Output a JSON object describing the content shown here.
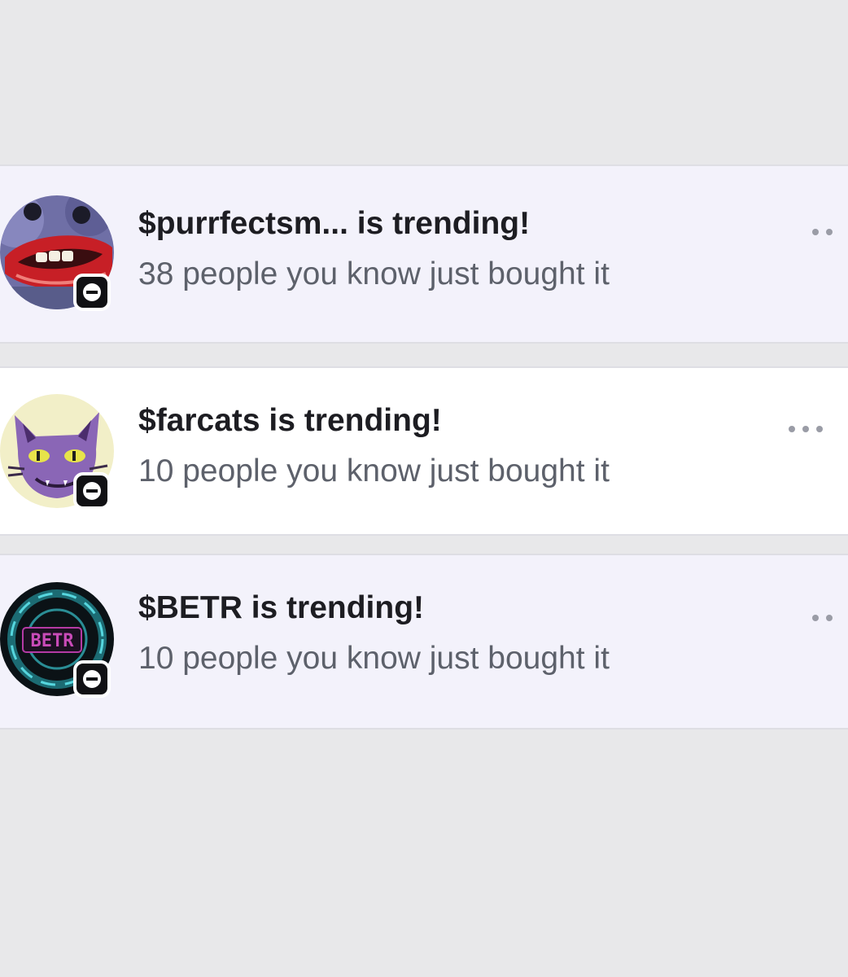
{
  "notifications": [
    {
      "title": "$purrfectsm... is trending!",
      "subtitle": "38 people you know just bought it",
      "highlighted": true,
      "avatar_icon": "red-lips-avatar-icon"
    },
    {
      "title": "$farcats is trending!",
      "subtitle": "10 people you know just bought it",
      "highlighted": false,
      "avatar_icon": "purple-cat-avatar-icon"
    },
    {
      "title": "$BETR is trending!",
      "subtitle": "10 people you know just bought it",
      "highlighted": true,
      "avatar_icon": "betr-chip-avatar-icon",
      "avatar_text": "BETR"
    }
  ],
  "colors": {
    "page_background": "#e8e8ea",
    "highlight_background": "#f3f2fb",
    "plain_background": "#ffffff",
    "title_text": "#1d1d22",
    "subtitle_text": "#5d616b"
  }
}
